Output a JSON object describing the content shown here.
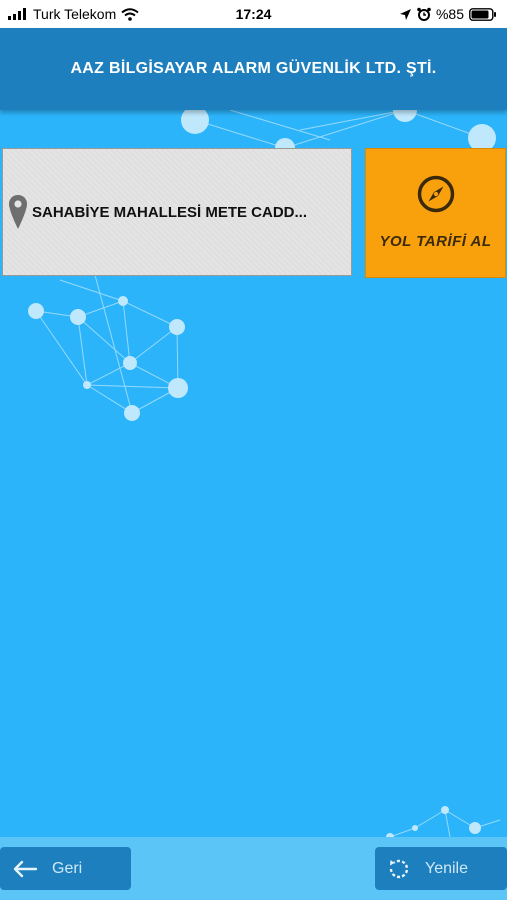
{
  "status_bar": {
    "carrier": "Turk Telekom",
    "time": "17:24",
    "battery": "%85",
    "icons": [
      "signal-bars-icon",
      "wifi-icon",
      "location-arrow-icon",
      "alarm-clock-icon",
      "battery-icon"
    ]
  },
  "header": {
    "title": "AAZ BİLGİSAYAR ALARM GÜVENLİK LTD. ŞTİ."
  },
  "address": {
    "text": "SAHABİYE MAHALLESİ METE CADD...",
    "icon": "map-pin-icon"
  },
  "directions": {
    "label": "YOL TARİFİ AL",
    "icon": "compass-icon",
    "color": "#f9a10d"
  },
  "footer": {
    "back_label": "Geri",
    "back_icon": "arrow-left-icon",
    "refresh_label": "Yenile",
    "refresh_icon": "refresh-icon"
  },
  "colors": {
    "header": "#1d7fbe",
    "background": "#2cb4fb",
    "footer": "#5cc5f8"
  }
}
